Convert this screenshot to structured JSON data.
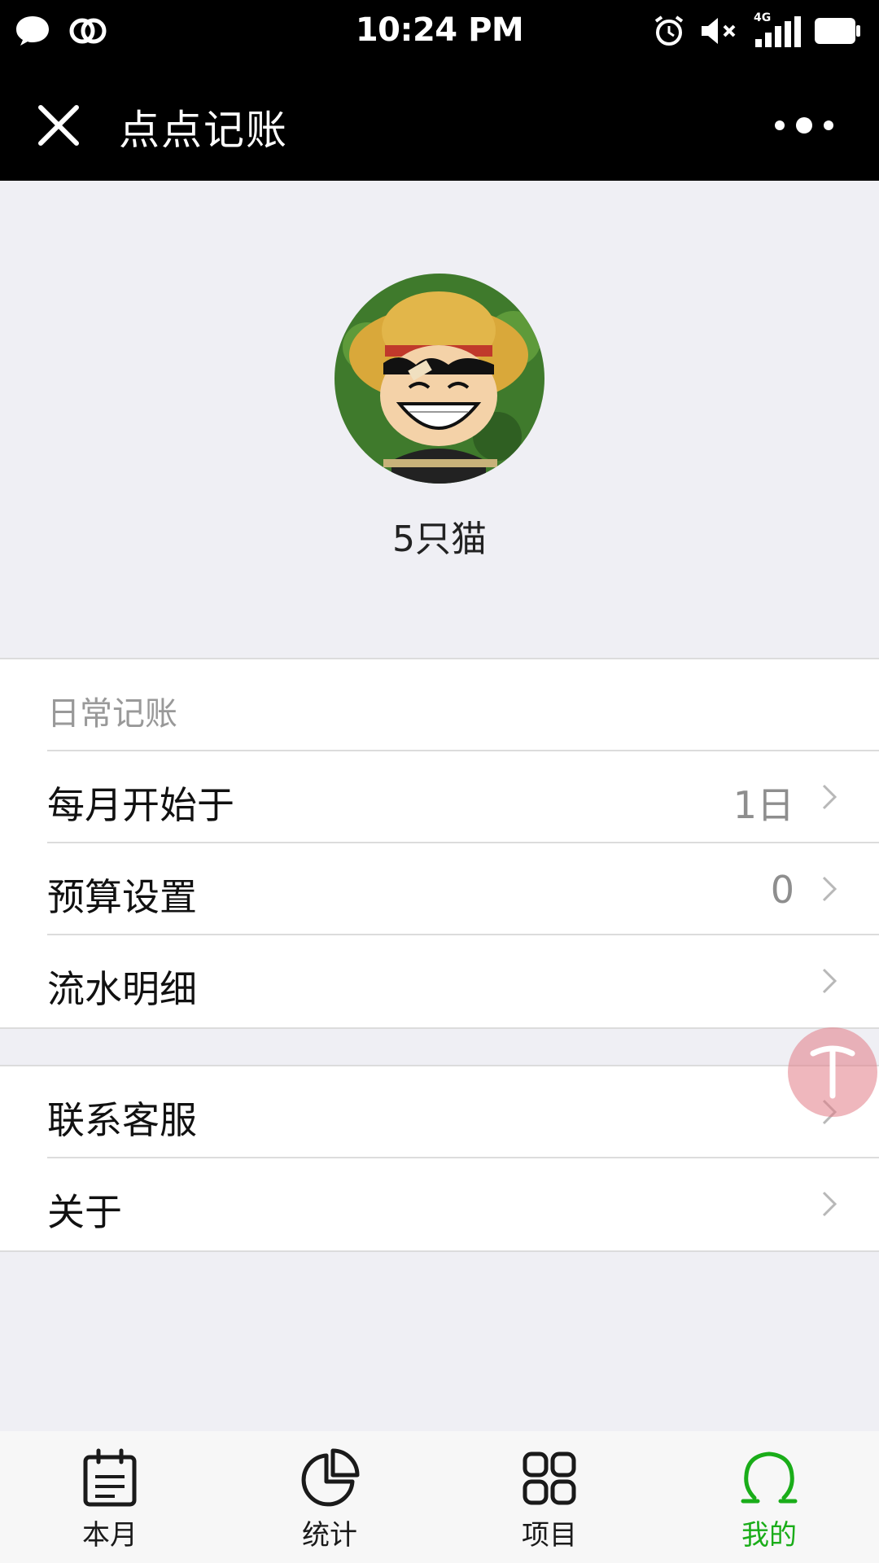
{
  "status_bar": {
    "time": "10:24 PM",
    "network": "4G"
  },
  "nav": {
    "title": "点点记账"
  },
  "profile": {
    "name": "5只猫"
  },
  "settings": {
    "section_title": "日常记账",
    "items": [
      {
        "label": "每月开始于",
        "value": "1日"
      },
      {
        "label": "预算设置",
        "value": "0"
      },
      {
        "label": "流水明细",
        "value": ""
      }
    ]
  },
  "support": {
    "items": [
      {
        "label": "联系客服"
      },
      {
        "label": "关于"
      }
    ]
  },
  "tabs": [
    {
      "label": "本月",
      "icon": "calendar-icon"
    },
    {
      "label": "统计",
      "icon": "pie-chart-icon"
    },
    {
      "label": "项目",
      "icon": "grid-icon"
    },
    {
      "label": "我的",
      "icon": "user-icon"
    }
  ],
  "colors": {
    "active_tab": "#1aad19",
    "float_button": "#e27c86"
  }
}
